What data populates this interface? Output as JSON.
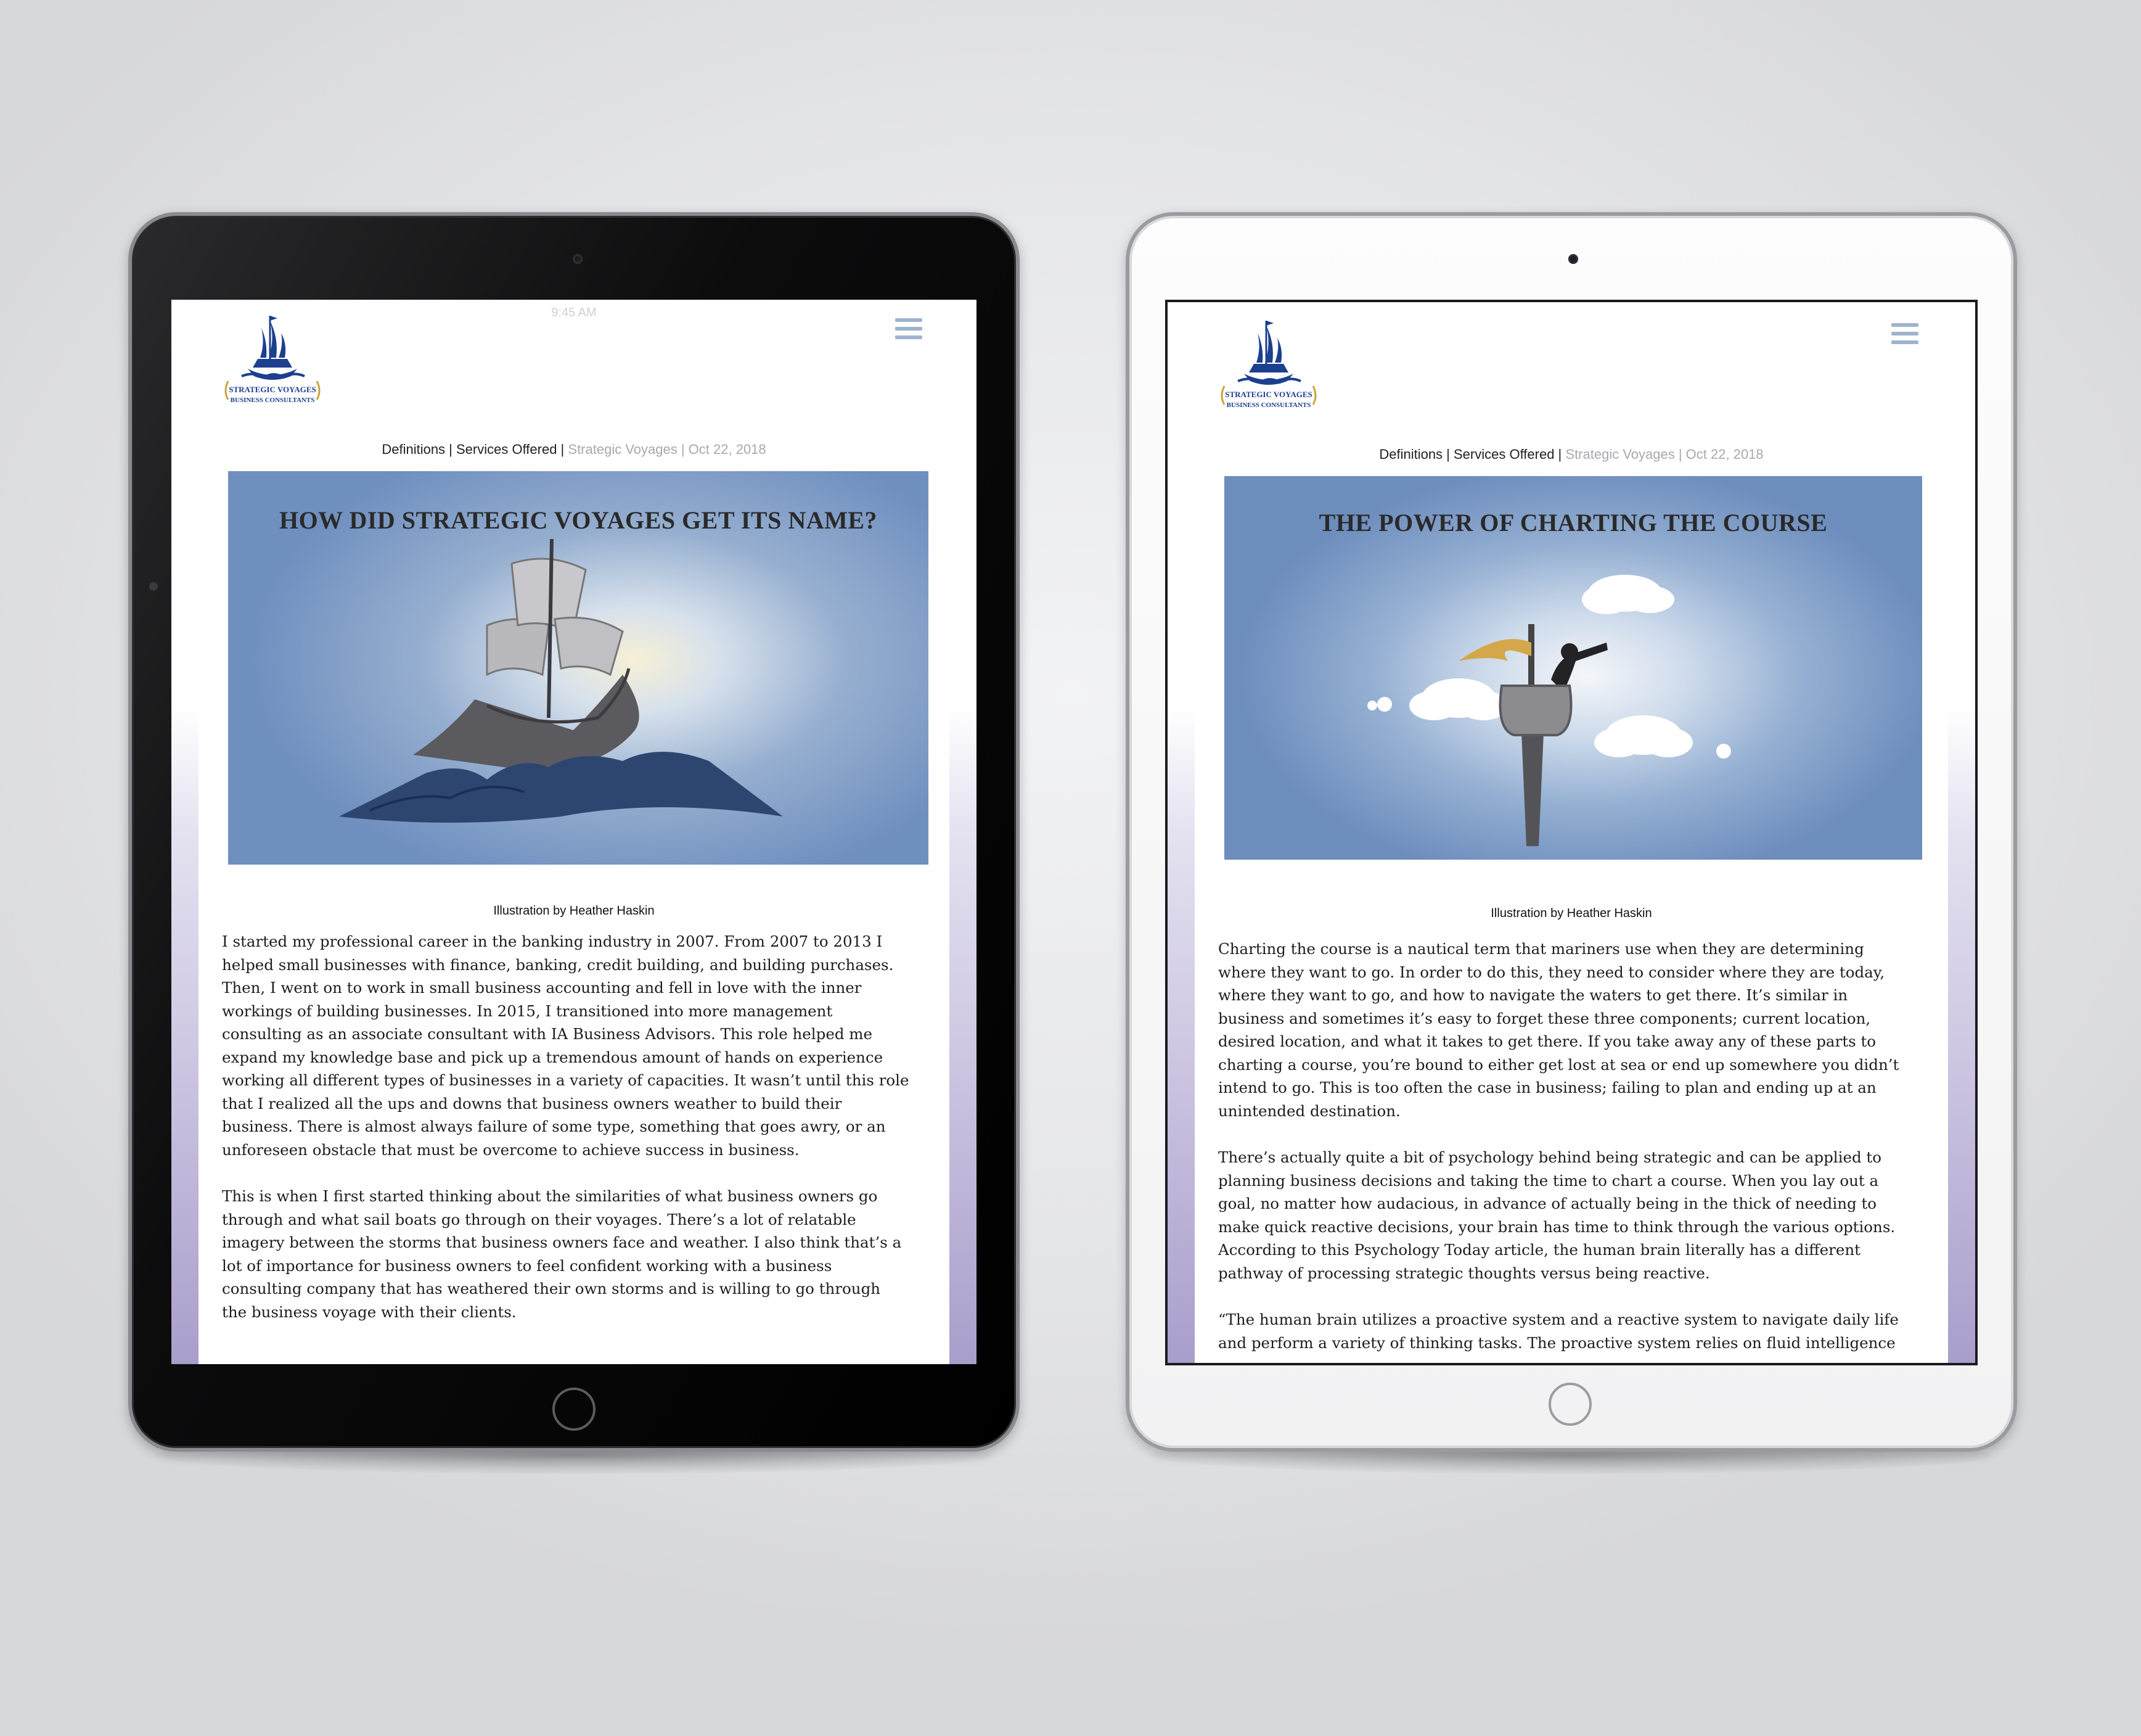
{
  "left_tablet": {
    "status_time": "9:45 AM",
    "logo_text_1": "STRATEGIC VOYAGES",
    "logo_text_2": "BUSINESS CONSULTANTS",
    "meta": {
      "categories": "Definitions | Services Offered | ",
      "author": "Strategic Voyages",
      "date": " | Oct 22, 2018"
    },
    "hero_title": "HOW DID STRATEGIC VOYAGES GET ITS NAME?",
    "caption": "Illustration by Heather Haskin",
    "paragraphs": [
      "I started my professional career in the banking industry in 2007. From 2007 to 2013 I\nhelped small businesses with finance, banking, credit building, and building purchases.\nThen, I went on to work in small business accounting and fell in love with the inner\nworkings of building businesses. In 2015, I transitioned into more management\nconsulting as an associate consultant with IA Business Advisors. This role helped me\nexpand my knowledge base and pick up a tremendous amount of hands on experience\nworking all different types of businesses in a variety of capacities. It wasn’t until this role\nthat I realized all the ups and downs that business owners weather to build their\nbusiness. There is almost always failure of some type, something that goes awry, or an\nunforeseen obstacle that must be overcome to achieve success in business.",
      "This is when I first started thinking about the similarities of what business owners go\nthrough and what sail boats go through on their voyages. There’s a lot of relatable\nimagery between the storms that business owners face and weather. I also think that’s a\nlot of importance for business owners to feel confident working with a business\nconsulting company that has weathered their own storms and is willing to go through\nthe business voyage with their clients."
    ]
  },
  "right_tablet": {
    "logo_text_1": "STRATEGIC VOYAGES",
    "logo_text_2": "BUSINESS CONSULTANTS",
    "meta": {
      "categories": "Definitions | Services Offered | ",
      "author": "Strategic Voyages",
      "date": " | Oct 22, 2018"
    },
    "hero_title": "THE POWER OF CHARTING THE COURSE",
    "caption": "Illustration by Heather Haskin",
    "paragraphs": [
      "Charting the course is a nautical term that mariners use when they are determining\nwhere they want to go. In order to do this, they need to consider where they are today,\nwhere they want to go, and how to navigate the waters to get there. It’s similar in\nbusiness and sometimes it’s easy to forget these three components; current location,\ndesired location, and what it takes to get there. If you take away any of these parts to\ncharting a course, you’re bound to either get lost at sea or end up somewhere you didn’t\nintend to go. This is too often the case in business; failing to plan and ending up at an\nunintended destination.",
      "There’s actually quite a bit of psychology behind being strategic and can be applied to\nplanning business decisions and taking the time to chart a course. When you lay out a\ngoal, no matter how audacious, in advance of actually being in the thick of needing to\nmake quick reactive decisions, your brain has time to think through the various options.\nAccording to this Psychology Today article, the human brain literally has a different\npathway of processing strategic thoughts versus being reactive.",
      "“The human brain utilizes a proactive system and a reactive system to navigate daily life\nand perform a variety of thinking tasks. The proactive system relies on fluid intelligence"
    ]
  },
  "colors": {
    "menu_icon": "#9fb3d0",
    "logo_blue": "#1c3f8f",
    "logo_gold": "#c9a43a",
    "muted_text": "#a7a9ae",
    "hero_blue": "#6f8fbf"
  }
}
